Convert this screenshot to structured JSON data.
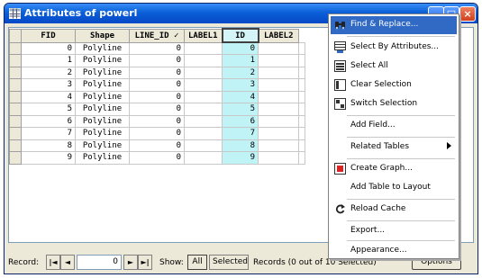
{
  "window": {
    "title": "Attributes of powerl",
    "buttons": [
      "_",
      "□",
      "×"
    ]
  },
  "table": {
    "columns": [
      "FID",
      "Shape",
      "LINE_ID ✓",
      "LABEL1",
      "ID",
      "LABEL2"
    ],
    "rows": [
      [
        "0",
        "Polyline",
        "0",
        "",
        "0",
        ""
      ],
      [
        "1",
        "Polyline",
        "0",
        "",
        "1",
        ""
      ],
      [
        "2",
        "Polyline",
        "0",
        "",
        "2",
        ""
      ],
      [
        "3",
        "Polyline",
        "0",
        "",
        "3",
        ""
      ],
      [
        "4",
        "Polyline",
        "0",
        "",
        "4",
        ""
      ],
      [
        "5",
        "Polyline",
        "0",
        "",
        "5",
        ""
      ],
      [
        "6",
        "Polyline",
        "0",
        "",
        "6",
        ""
      ],
      [
        "7",
        "Polyline",
        "0",
        "",
        "7",
        ""
      ],
      [
        "8",
        "Polyline",
        "0",
        "",
        "8",
        ""
      ],
      [
        "9",
        "Polyline",
        "0",
        "",
        "9",
        ""
      ]
    ],
    "highlighted_column": "ID"
  },
  "status": {
    "record_label": "Record:",
    "record_value": "0",
    "nav": {
      "first": "|◄",
      "prev": "◄",
      "next": "►",
      "last": "►|"
    },
    "show_label": "Show:",
    "all_button": "All",
    "selected_button": "Selected",
    "records_text": "Records (0 out of 10 Selected)",
    "options_button": "Options"
  },
  "menu": {
    "items": [
      {
        "label": "Find & Replace...",
        "icon": "binoculars-icon",
        "active": true
      },
      {
        "label": "Select By Attributes...",
        "icon": "select-attributes-icon"
      },
      {
        "label": "Select All",
        "icon": "select-all-icon"
      },
      {
        "label": "Clear Selection",
        "icon": "clear-selection-icon"
      },
      {
        "label": "Switch Selection",
        "icon": "switch-selection-icon"
      },
      {
        "label": "Add Field..."
      },
      {
        "label": "Related Tables",
        "submenu": true
      },
      {
        "label": "Create Graph...",
        "icon": "graph-icon"
      },
      {
        "label": "Add Table to Layout"
      },
      {
        "label": "Reload Cache",
        "icon": "reload-icon"
      },
      {
        "label": "Export..."
      },
      {
        "label": "Appearance..."
      }
    ]
  },
  "colors": {
    "titlebar": "#0a5fd8",
    "menu_highlight": "#316ac5",
    "id_column": "#bff3f6"
  }
}
